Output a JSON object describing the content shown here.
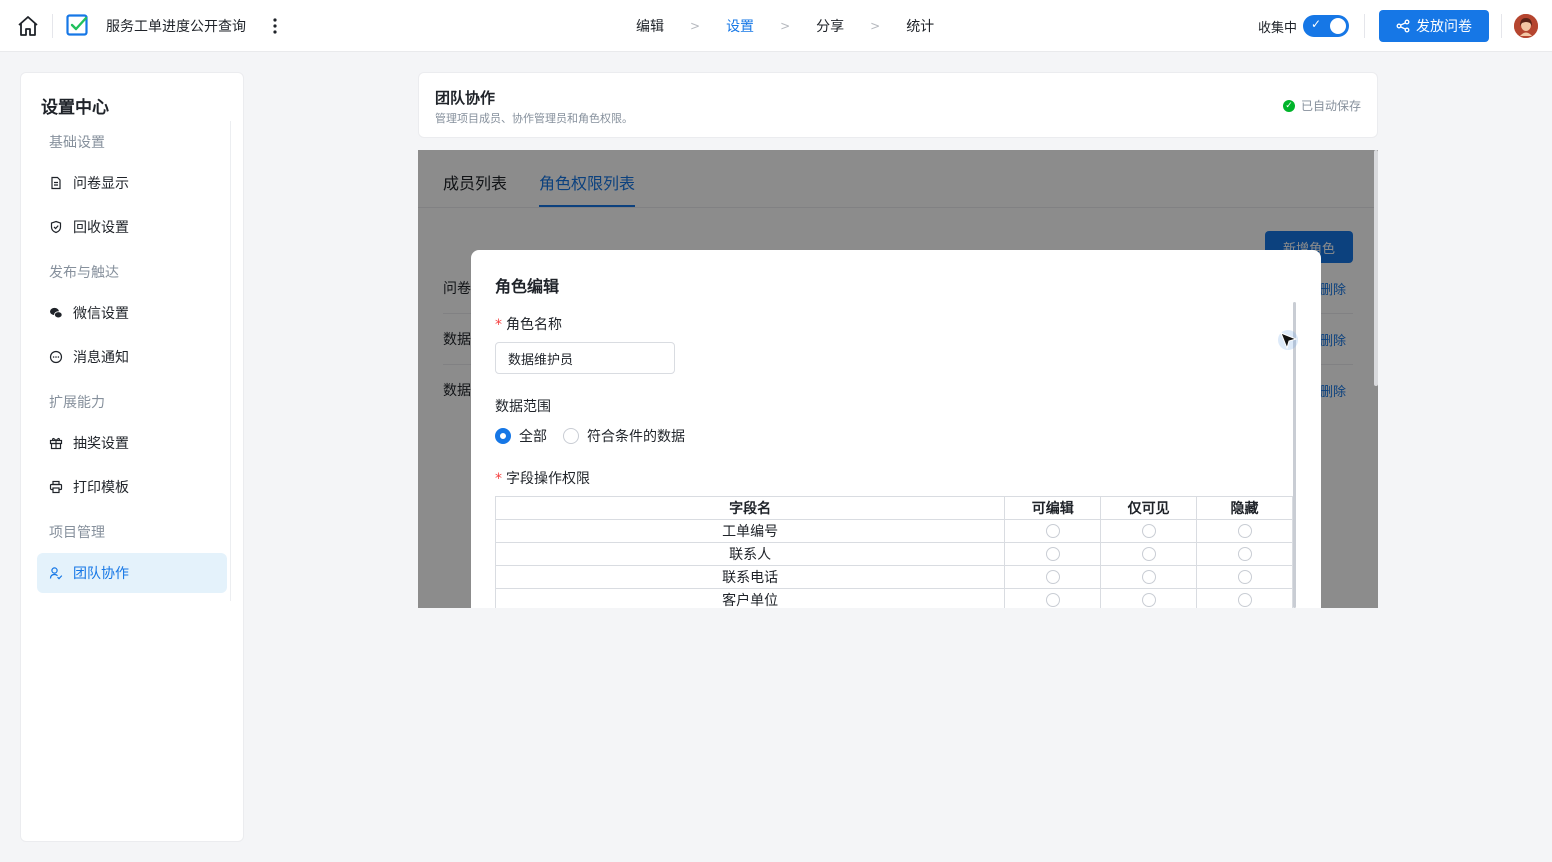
{
  "topbar": {
    "app_title": "服务工单进度公开查询",
    "steps": [
      {
        "label": "编辑",
        "active": false
      },
      {
        "label": "设置",
        "active": true
      },
      {
        "label": "分享",
        "active": false
      },
      {
        "label": "统计",
        "active": false
      }
    ],
    "step_separator": ">",
    "collect_label": "收集中",
    "collect_on": true,
    "publish_label": "发放问卷",
    "accent_color": "#1677e6"
  },
  "sidebar": {
    "title": "设置中心",
    "groups": [
      {
        "label": "基础设置",
        "items": [
          {
            "label": "问卷显示",
            "icon": "document-icon"
          },
          {
            "label": "回收设置",
            "icon": "shield-check-icon"
          }
        ]
      },
      {
        "label": "发布与触达",
        "items": [
          {
            "label": "微信设置",
            "icon": "wechat-icon"
          },
          {
            "label": "消息通知",
            "icon": "chat-bubble-icon"
          }
        ]
      },
      {
        "label": "扩展能力",
        "items": [
          {
            "label": "抽奖设置",
            "icon": "gift-icon"
          },
          {
            "label": "打印模板",
            "icon": "printer-icon"
          }
        ]
      },
      {
        "label": "项目管理",
        "items": [
          {
            "label": "团队协作",
            "icon": "team-icon",
            "active": true
          }
        ]
      }
    ]
  },
  "header": {
    "title": "团队协作",
    "description": "管理项目成员、协作管理员和角色权限。",
    "saved_label": "已自动保存"
  },
  "main": {
    "tabs": [
      {
        "label": "成员列表",
        "active": false
      },
      {
        "label": "角色权限列表",
        "active": true
      }
    ],
    "new_role_label": "新增角色",
    "rows": [
      {
        "label": "问卷",
        "action": "删除"
      },
      {
        "label": "数据",
        "action": "删除"
      },
      {
        "label": "数据",
        "action": "删除"
      }
    ]
  },
  "modal": {
    "title": "角色编辑",
    "role_name_label": "角色名称",
    "role_name_value": "数据维护员",
    "data_scope_label": "数据范围",
    "scope_options": [
      {
        "label": "全部",
        "checked": true
      },
      {
        "label": "符合条件的数据",
        "checked": false
      }
    ],
    "field_perm_label": "字段操作权限",
    "table_headers": [
      "字段名",
      "可编辑",
      "仅可见",
      "隐藏"
    ],
    "table_rows": [
      "工单编号",
      "联系人",
      "联系电话",
      "客户单位"
    ]
  }
}
